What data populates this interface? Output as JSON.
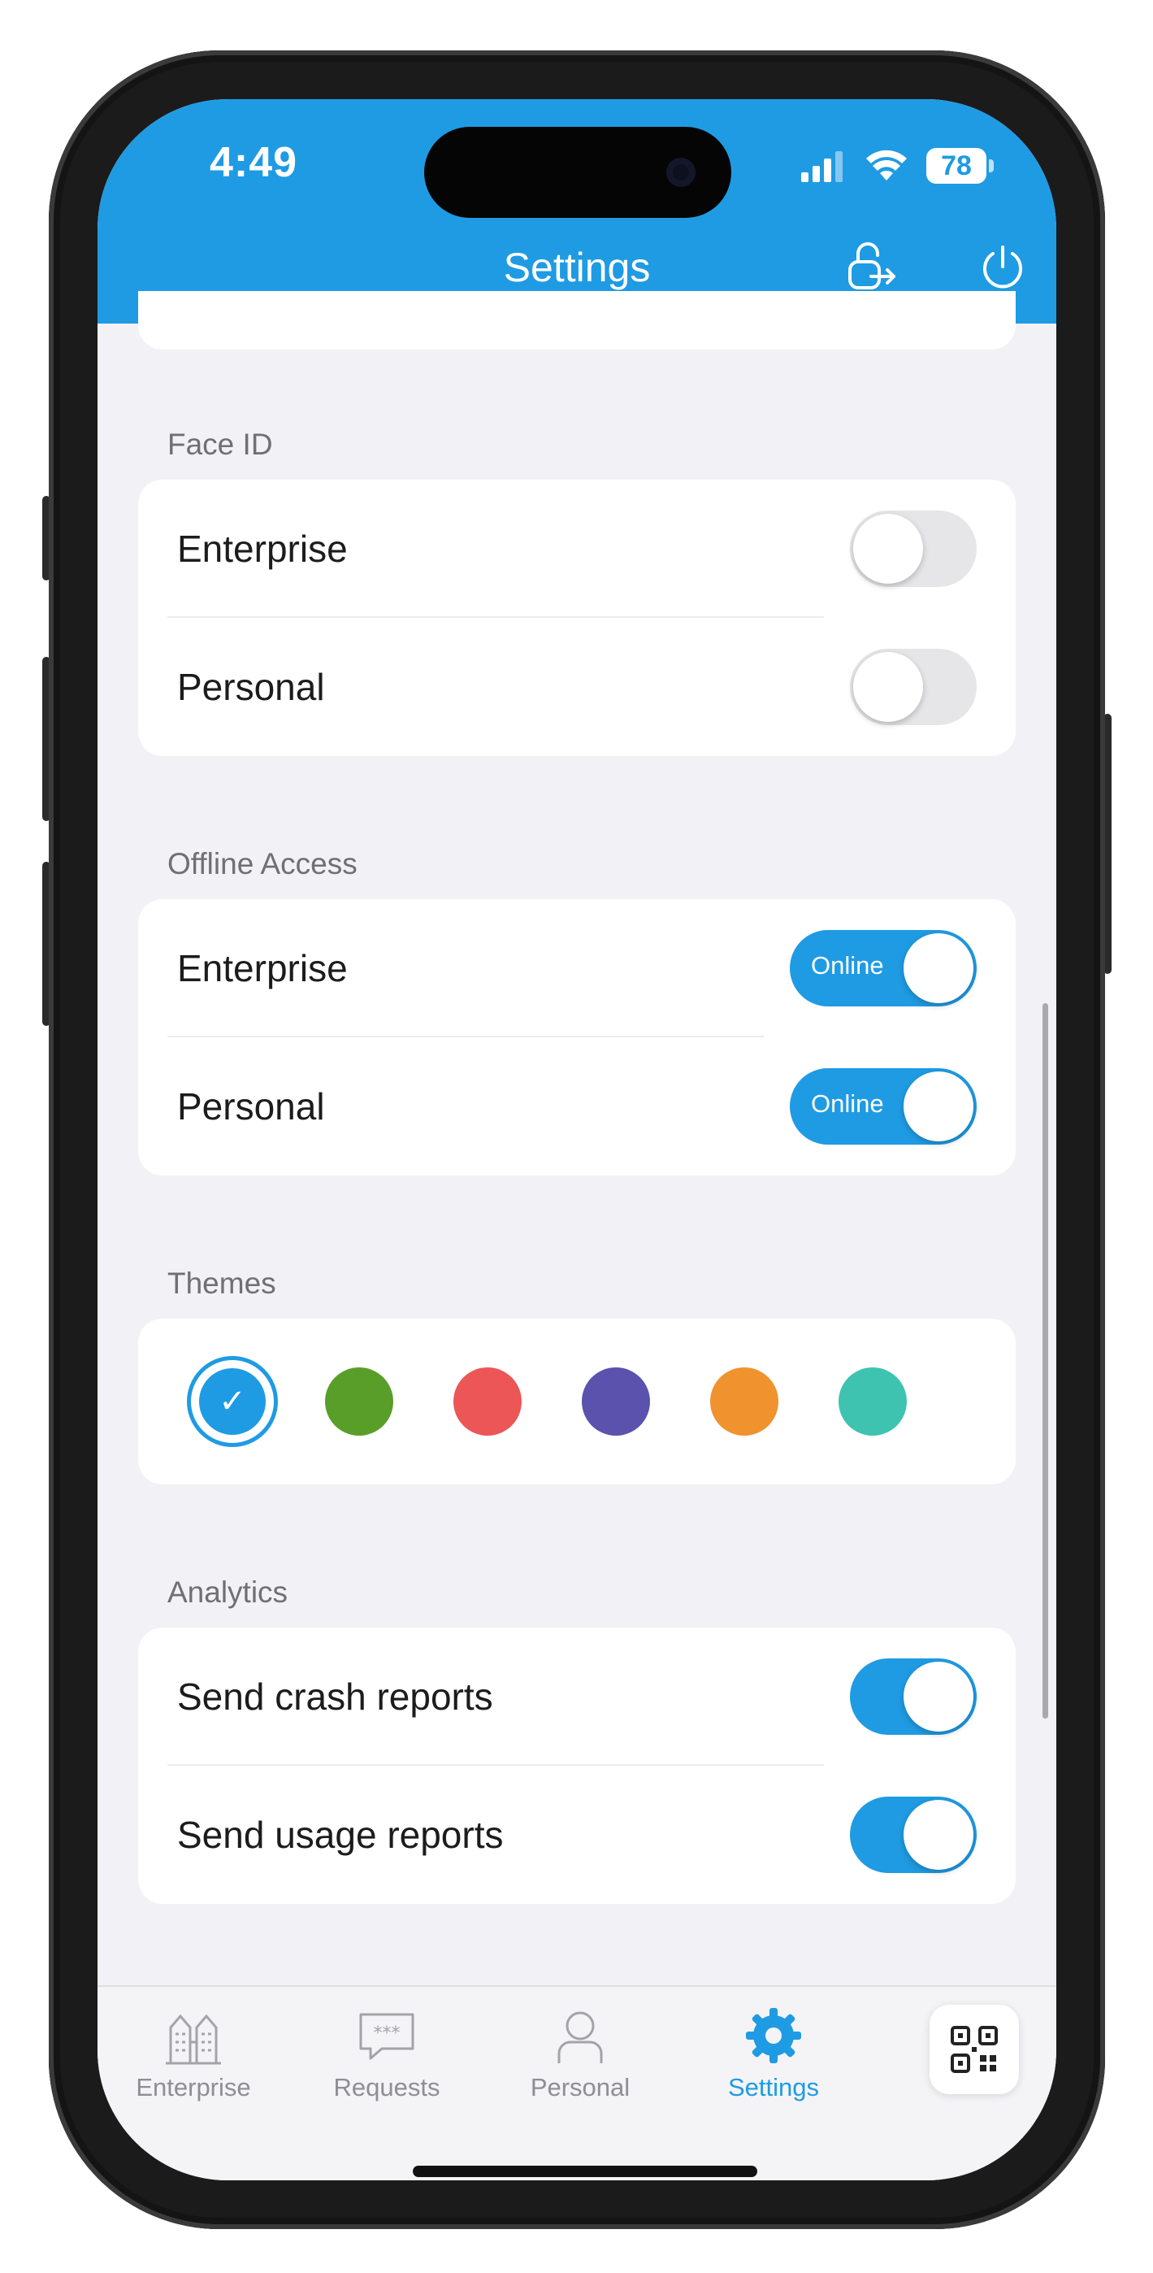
{
  "status_bar": {
    "time": "4:49",
    "battery": "78"
  },
  "header": {
    "title": "Settings"
  },
  "sections": {
    "face_id": {
      "label": "Face ID",
      "rows": [
        {
          "label": "Enterprise",
          "enabled": false
        },
        {
          "label": "Personal",
          "enabled": false
        }
      ]
    },
    "offline_access": {
      "label": "Offline Access",
      "rows": [
        {
          "label": "Enterprise",
          "toggle_text": "Online",
          "enabled": true
        },
        {
          "label": "Personal",
          "toggle_text": "Online",
          "enabled": true
        }
      ]
    },
    "themes": {
      "label": "Themes",
      "swatches": [
        "#1f9be3",
        "#5a9e2a",
        "#ec5656",
        "#5a52ad",
        "#f0932e",
        "#3ec3b0"
      ],
      "selected_index": 0,
      "selected_glyph": "✓"
    },
    "analytics": {
      "label": "Analytics",
      "rows": [
        {
          "label": "Send crash reports",
          "enabled": true
        },
        {
          "label": "Send usage reports",
          "enabled": true
        }
      ]
    }
  },
  "tab_bar": {
    "tabs": [
      {
        "label": "Enterprise",
        "icon": "buildings-icon"
      },
      {
        "label": "Requests",
        "icon": "chat-bubble-icon"
      },
      {
        "label": "Personal",
        "icon": "person-icon"
      },
      {
        "label": "Settings",
        "icon": "gear-icon",
        "active": true
      }
    ],
    "qr_icon": "qr-code-icon"
  },
  "colors": {
    "accent": "#1f9be3",
    "background": "#f1f1f6"
  }
}
